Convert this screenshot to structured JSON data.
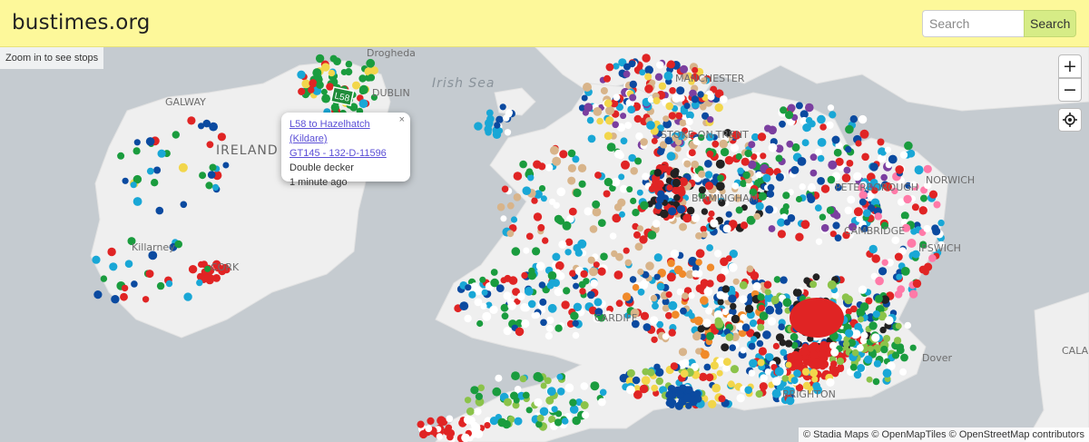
{
  "header": {
    "brand": "bustimes.org",
    "search_placeholder": "Search",
    "search_button": "Search"
  },
  "map": {
    "notice": "Zoom in to see stops",
    "zoom_in": "+",
    "zoom_out": "−",
    "locate_icon": "crosshair-icon",
    "labels": {
      "sea": "Irish Sea",
      "ireland": "IRELAND",
      "galway": "GALWAY",
      "dublin": "DUBLIN",
      "killarney": "Killarney",
      "cork": "CORK",
      "peterborough": "PETERBOROUGH",
      "cambridge": "CAMBRIDGE",
      "ipswich": "IPSWICH",
      "norwich": "NORWICH",
      "dover": "Dover",
      "calais": "CALAIS",
      "manchester": "MANCHESTER",
      "stoke": "STOKE-ON-TRENT",
      "birmingham": "BIRMINGHAM",
      "cardiff": "CARDIFF",
      "brighton": "BRIGHTON",
      "drogheda": "Drogheda"
    },
    "marker_label": "L58",
    "attribution": "© Stadia Maps © OpenMapTiles © OpenStreetMap contributors"
  },
  "popup": {
    "route": "L58 to Hazelhatch (Kildare)",
    "vehicle": "GT145 - 132-D-11596",
    "type": "Double decker",
    "time": "1 minute ago",
    "close": "×"
  },
  "colors": {
    "header_bg": "#fdf89a",
    "search_button_bg": "#d6ec86",
    "land": "#efefef",
    "sea": "#c5cbd0"
  }
}
